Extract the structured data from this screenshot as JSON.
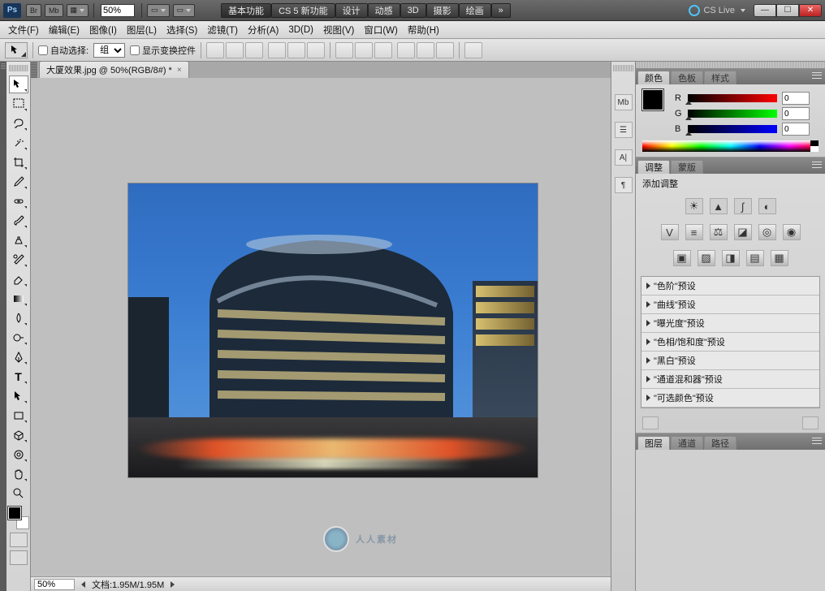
{
  "app_bar": {
    "logo": "Ps",
    "chips": [
      "Br",
      "Mb"
    ],
    "zoom": "50%",
    "workspaces": [
      "基本功能",
      "CS 5 新功能",
      "设计",
      "动感",
      "3D",
      "摄影",
      "绘画"
    ],
    "cslive": "CS Live"
  },
  "menu": [
    "文件(F)",
    "编辑(E)",
    "图像(I)",
    "图层(L)",
    "选择(S)",
    "滤镜(T)",
    "分析(A)",
    "3D(D)",
    "视图(V)",
    "窗口(W)",
    "帮助(H)"
  ],
  "options": {
    "auto_select": "自动选择:",
    "group": "组",
    "show_transform": "显示变换控件"
  },
  "document": {
    "tab_title": "大厦效果.jpg @ 50%(RGB/8#) *",
    "zoom_status": "50%",
    "doc_info": "文档:1.95M/1.95M"
  },
  "color_panel": {
    "tabs": [
      "颜色",
      "色板",
      "样式"
    ],
    "channels": {
      "r_label": "R",
      "g_label": "G",
      "b_label": "B",
      "r": "0",
      "g": "0",
      "b": "0"
    }
  },
  "adjust_panel": {
    "tabs": [
      "调整",
      "蒙版"
    ],
    "heading": "添加调整",
    "presets": [
      "\"色阶\"预设",
      "\"曲线\"预设",
      "\"曝光度\"预设",
      "\"色相/饱和度\"预设",
      "\"黑白\"预设",
      "\"通道混和器\"预设",
      "\"可选颜色\"预设"
    ]
  },
  "layers_panel": {
    "tabs": [
      "图层",
      "通道",
      "路径"
    ]
  },
  "watermark": "人人素材"
}
